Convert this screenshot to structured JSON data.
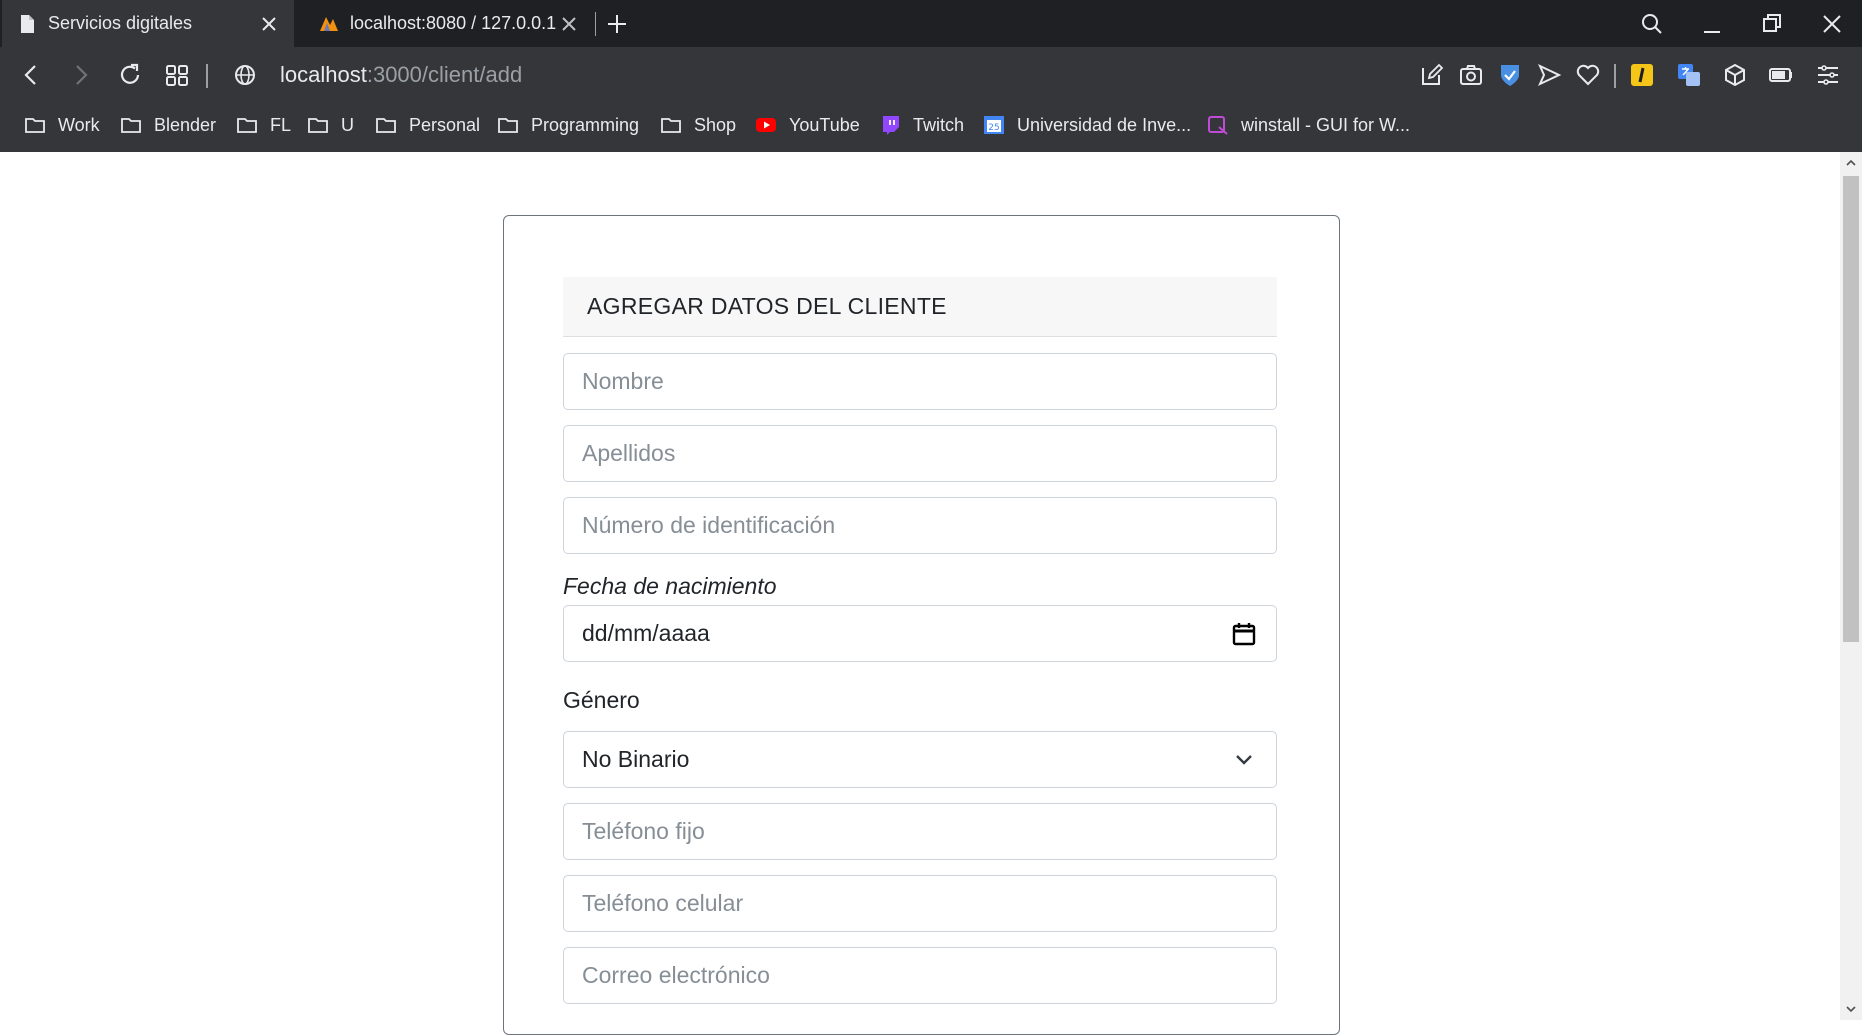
{
  "browser": {
    "tabs": [
      {
        "title": "Servicios digitales",
        "active": true
      },
      {
        "title": "localhost:8080 / 127.0.0.1 /",
        "active": false
      }
    ],
    "address": {
      "host": "localhost",
      "path": ":3000/client/add"
    },
    "bookmarks": [
      {
        "label": "Work",
        "icon": "folder-icon"
      },
      {
        "label": "Blender",
        "icon": "folder-icon"
      },
      {
        "label": "FL",
        "icon": "folder-icon"
      },
      {
        "label": "U",
        "icon": "folder-icon"
      },
      {
        "label": "Personal",
        "icon": "folder-icon"
      },
      {
        "label": "Programming",
        "icon": "folder-icon"
      },
      {
        "label": "Shop",
        "icon": "folder-icon"
      },
      {
        "label": "YouTube",
        "icon": "youtube-icon"
      },
      {
        "label": "Twitch",
        "icon": "twitch-icon"
      },
      {
        "label": "Universidad de Inve...",
        "icon": "calendar-icon"
      },
      {
        "label": "winstall - GUI for W...",
        "icon": "winstall-icon"
      }
    ],
    "colors": {
      "tabstrip": "#1f2023",
      "toolbar": "#35363a",
      "text": "#e8eaed"
    }
  },
  "form": {
    "header": "AGREGAR DATOS DEL CLIENTE",
    "nombre_placeholder": "Nombre",
    "apellidos_placeholder": "Apellidos",
    "identificacion_placeholder": "Número de identificación",
    "fecha_label": "Fecha de nacimiento",
    "fecha_value": "dd/mm/aaaa",
    "genero_label": "Género",
    "genero_value": "No Binario",
    "telefono_fijo_placeholder": "Teléfono fijo",
    "telefono_celular_placeholder": "Teléfono celular",
    "correo_placeholder": "Correo electrónico"
  }
}
